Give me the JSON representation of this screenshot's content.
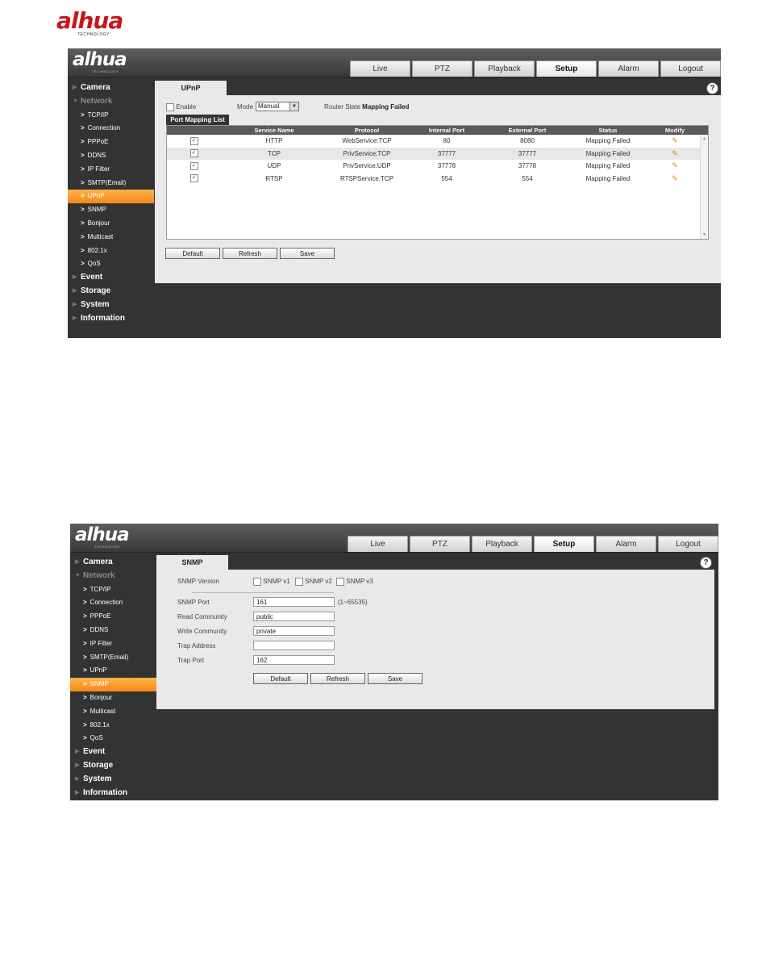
{
  "brand": {
    "name": "alhua",
    "sub": "TECHNOLOGY"
  },
  "tabs": [
    "Live",
    "PTZ",
    "Playback",
    "Setup",
    "Alarm",
    "Logout"
  ],
  "active_tab": "Setup",
  "sidebar": {
    "camera": "Camera",
    "network": "Network",
    "network_items": [
      "TCP/IP",
      "Connection",
      "PPPoE",
      "DDNS",
      "IP Filter",
      "SMTP(Email)",
      "UPnP",
      "SNMP",
      "Bonjour",
      "Multicast",
      "802.1x",
      "QoS"
    ],
    "event": "Event",
    "storage": "Storage",
    "system": "System",
    "information": "Information"
  },
  "upnp": {
    "tab_title": "UPnP",
    "help": "?",
    "enable_label": "Enable",
    "mode_label": "Mode",
    "mode_value": "Manual",
    "router_state_label": "Router State",
    "router_state_value": "Mapping Failed",
    "list_tab": "Port Mapping List",
    "columns": [
      "Service Name",
      "Protocol",
      "Internal Port",
      "External Port",
      "Status",
      "Modify"
    ],
    "rows": [
      {
        "checked": true,
        "service": "HTTP",
        "protocol": "WebService:TCP",
        "internal": "80",
        "external": "8080",
        "status": "Mapping Failed"
      },
      {
        "checked": true,
        "service": "TCP",
        "protocol": "PrivService:TCP",
        "internal": "37777",
        "external": "37777",
        "status": "Mapping Failed"
      },
      {
        "checked": true,
        "service": "UDP",
        "protocol": "PrivService:UDP",
        "internal": "37778",
        "external": "37778",
        "status": "Mapping Failed"
      },
      {
        "checked": true,
        "service": "RTSP",
        "protocol": "RTSPService:TCP",
        "internal": "554",
        "external": "554",
        "status": "Mapping Failed"
      }
    ],
    "buttons": {
      "default": "Default",
      "refresh": "Refresh",
      "save": "Save"
    }
  },
  "snmp": {
    "tab_title": "SNMP",
    "help": "?",
    "version_label": "SNMP Version",
    "versions": [
      "SNMP v1",
      "SNMP v2",
      "SNMP v3"
    ],
    "port_label": "SNMP Port",
    "port_value": "161",
    "port_range": "(1~65535)",
    "read_label": "Read Community",
    "read_value": "public",
    "write_label": "Write Community",
    "write_value": "private",
    "trap_addr_label": "Trap Address",
    "trap_addr_value": "",
    "trap_port_label": "Trap Port",
    "trap_port_value": "162",
    "buttons": {
      "default": "Default",
      "refresh": "Refresh",
      "save": "Save"
    }
  },
  "colors": {
    "accent": "#f7881a",
    "panel": "#333333",
    "brand": "#c8161d"
  }
}
